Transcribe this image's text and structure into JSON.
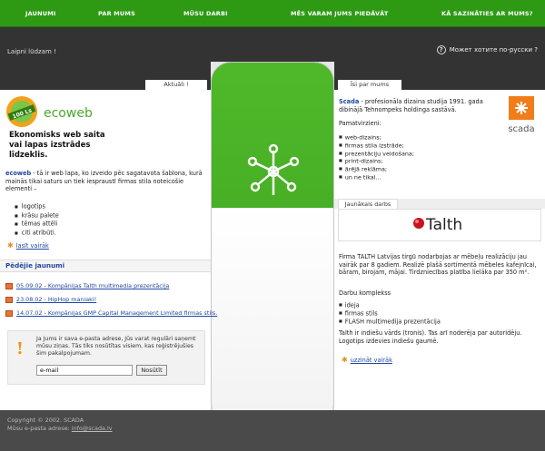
{
  "nav": {
    "items": [
      "JAUNUMI",
      "PAR MUMS",
      "MŪSU DARBI",
      "MĒS VARAM JUMS PIEDĀVĀT",
      "KĀ SAZINĀTIES AR MUMS?"
    ]
  },
  "header": {
    "welcome": "Laipni lūdzam !",
    "language_link": "Может хотите по-русски ?"
  },
  "tabs": {
    "news": "Aktuāli !",
    "about": "Īsi par mums",
    "work": "Jaunākais darbs"
  },
  "promo": {
    "logo_text": "ecoweb",
    "badge_text": "100 Ls",
    "title": "Ekonomisks web saita vai lapas izstrādes līdzeklis.",
    "intro_bold": "ecoweb",
    "intro_rest": " - tā ir web lapa, ko izveido pēc sagatavota šablona, kurā mainās tikai saturs un tiek iespraustī firmas stila noteicošie elementi –",
    "features": [
      "logotips",
      "krāsu palete",
      "tēmas attēli",
      "citi atribūti."
    ],
    "more": "lasīt vairāk"
  },
  "news": {
    "title": "Pēdējie jaunumi",
    "items": [
      "05.09.02 - Kompānijas Talth multimedia prezentācija",
      "23.08.02 - HipHop maniaki!",
      "14.07.02 - Kompānijas GMP Capital Management Limited firmas stils."
    ]
  },
  "subscribe": {
    "text": "Ja Jums ir savа e-pasta adrese, Jūs varat regulāri saņemt mūsu ziņas. Tās tiks nosūtītas visiem, kas reģistrējušies šim pakalpojumam.",
    "input_value": "e-mail",
    "button": "Nosūtīt"
  },
  "about": {
    "name": "Scada",
    "text": " - profesionāla dizaina studija 1991. gada dibinājā Tehnompeks holdinga sastāvā.",
    "logo_text": "scada",
    "services_head": "Pamatvirzieni:",
    "services": [
      "web-dizains;",
      "firmas stila izstrāde;",
      "prezentāciju veidošana;",
      "print-dizains;",
      "ārējā reklāma;",
      "un ne tikai..."
    ]
  },
  "work": {
    "logo_text": "Talth",
    "text": "Firma TALTH Latvijas tirgū nodarbojas ar mēbeļu realizāciju jau vairāk par 8 gadiem. Realizē plašā sortimentā mēbeles kafejnīcai, bāram, birojam, mājai. Tirdzniecības platība lielāka par 350 m².",
    "package_head": "Darbu komplekss",
    "package": [
      "ideja",
      "firmas stils",
      "FLASH multimedija prezentācija"
    ],
    "note": "Talth ir indiešu vārds (tronis). Tas arī noderēja par autoridēju. Logotips izdevies indiešu gaumē.",
    "more": "uzzināt vairāk"
  },
  "footer": {
    "copyright": "Copyright © 2002. SCADA",
    "email_label": "Mūsu e-pasta adrese: ",
    "email": "info@scada.lv"
  },
  "colors": {
    "green": "#2e9a14",
    "dark": "#333333",
    "link": "#1f48a0",
    "accent": "#e98b1a"
  }
}
